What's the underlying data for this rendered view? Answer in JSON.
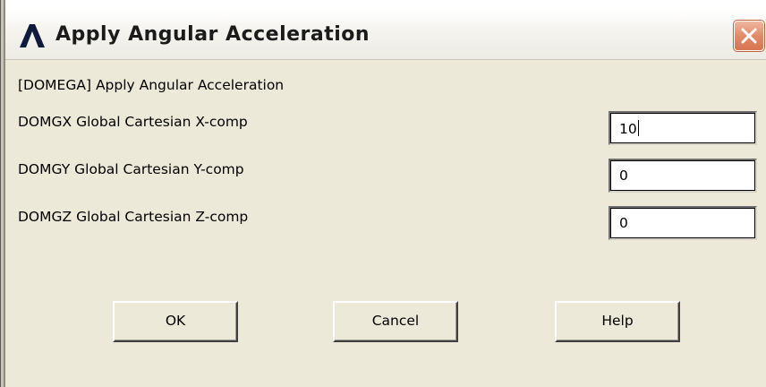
{
  "window": {
    "title": "Apply Angular Acceleration",
    "logo_icon": "ansys-logo-icon",
    "close_icon": "close-icon"
  },
  "dialog": {
    "command": "[DOMEGA]  Apply Angular Acceleration",
    "fields": [
      {
        "label": "DOMGX  Global Cartesian X-comp",
        "value": "10"
      },
      {
        "label": "DOMGY  Global Cartesian Y-comp",
        "value": "0"
      },
      {
        "label": "DOMGZ  Global Cartesian Z-comp",
        "value": "0"
      }
    ]
  },
  "buttons": {
    "ok": "OK",
    "cancel": "Cancel",
    "help": "Help"
  },
  "colors": {
    "logo": "#0f1a3c",
    "close_button": "#e08b6a",
    "dialog_background": "#ece9d8"
  }
}
